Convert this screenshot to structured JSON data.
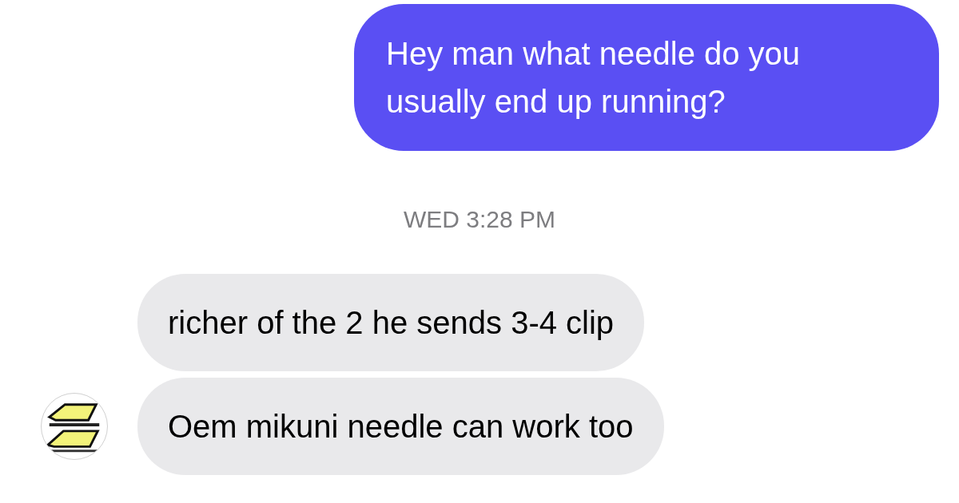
{
  "messages": [
    {
      "kind": "sent",
      "text": "Hey man what needle do you usually end up running?"
    },
    {
      "kind": "timestamp",
      "text": "WED 3:28 PM"
    },
    {
      "kind": "received",
      "text": "richer of the 2 he sends 3-4 clip",
      "avatar": false
    },
    {
      "kind": "received",
      "text": "Oem mikuni needle can work too",
      "avatar": true
    }
  ]
}
